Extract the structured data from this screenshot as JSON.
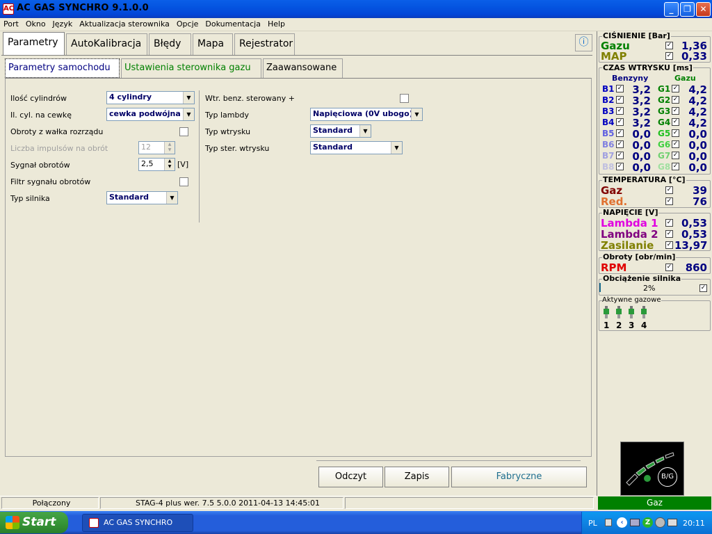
{
  "window": {
    "title": "AC GAS SYNCHRO  9.1.0.0",
    "icon_label": "AC"
  },
  "menu": [
    "Port",
    "Okno",
    "Język",
    "Aktualizacja sterownika",
    "Opcje",
    "Dokumentacja",
    "Help"
  ],
  "main_tabs": [
    "Parametry",
    "AutoKalibracja",
    "Błędy",
    "Mapa",
    "Rejestrator"
  ],
  "sub_tabs": [
    "Parametry samochodu",
    "Ustawienia sterownika gazu",
    "Zaawansowane"
  ],
  "left_form": {
    "cylinders": {
      "label": "Ilość cylindrów",
      "value": "4 cylindry"
    },
    "coil": {
      "label": "Il. cyl. na cewkę",
      "value": "cewka podwójna"
    },
    "camshaft": {
      "label": "Obroty z wałka rozrządu",
      "checked": false
    },
    "pulses": {
      "label": "Liczba impulsów na obrót",
      "value": "12"
    },
    "rpm_signal": {
      "label": "Sygnał obrotów",
      "value": "2,5",
      "unit": "[V]"
    },
    "rpm_filter": {
      "label": "Filtr sygnału obrotów",
      "checked": false
    },
    "engine_type": {
      "label": "Typ silnika",
      "value": "Standard"
    }
  },
  "right_form": {
    "petrol_inj": {
      "label": "Wtr. benz. sterowany +",
      "checked": false
    },
    "lambda": {
      "label": "Typ lambdy",
      "value": "Napięciowa (0V ubogo)"
    },
    "injection": {
      "label": "Typ wtrysku",
      "value": "Standard"
    },
    "inj_control": {
      "label": "Typ ster. wtrysku",
      "value": "Standard"
    }
  },
  "buttons": {
    "read": "Odczyt",
    "write": "Zapis",
    "factory": "Fabryczne"
  },
  "status": {
    "connection": "Połączony",
    "device": "STAG-4 plus   wer. 7.5  5.0.0    2011-04-13 14:45:01",
    "mode": "Gaz"
  },
  "pressure": {
    "title": "CIŚNIENIE [Bar]",
    "rows": [
      {
        "label": "Gazu",
        "value": "1,36",
        "color": "#008000"
      },
      {
        "label": "MAP",
        "value": "0,33",
        "color": "#808000"
      }
    ]
  },
  "injection_time": {
    "title": "CZAS WTRYSKU  [ms]",
    "col_petrol": "Benzyny",
    "col_gas": "Gazu",
    "rows": [
      {
        "b": "B1",
        "bv": "3,2",
        "g": "G1",
        "gv": "4,2"
      },
      {
        "b": "B2",
        "bv": "3,2",
        "g": "G2",
        "gv": "4,2"
      },
      {
        "b": "B3",
        "bv": "3,2",
        "g": "G3",
        "gv": "4,2"
      },
      {
        "b": "B4",
        "bv": "3,2",
        "g": "G4",
        "gv": "4,2"
      },
      {
        "b": "B5",
        "bv": "0,0",
        "g": "G5",
        "gv": "0,0"
      },
      {
        "b": "B6",
        "bv": "0,0",
        "g": "G6",
        "gv": "0,0"
      },
      {
        "b": "B7",
        "bv": "0,0",
        "g": "G7",
        "gv": "0,0"
      },
      {
        "b": "B8",
        "bv": "0,0",
        "g": "G8",
        "gv": "0,0"
      }
    ]
  },
  "temperature": {
    "title": "TEMPERATURA  [°C]",
    "rows": [
      {
        "label": "Gaz",
        "value": "39",
        "color": "#800000"
      },
      {
        "label": "Red.",
        "value": "76",
        "color": "#e07030"
      }
    ]
  },
  "voltage": {
    "title": "NAPIĘCIE [V]",
    "rows": [
      {
        "label": "Lambda 1",
        "value": "0,53",
        "color": "#e000e0"
      },
      {
        "label": "Lambda 2",
        "value": "0,53",
        "color": "#800080"
      },
      {
        "label": "Zasilanie",
        "value": "13,97",
        "color": "#808000"
      }
    ]
  },
  "rpm": {
    "title": "Obroty [obr/min]",
    "label": "RPM",
    "value": "860",
    "color": "#e00000"
  },
  "load": {
    "title": "Obciążenie silnika",
    "value": "2%",
    "fraction": 0.02
  },
  "active_gas": {
    "title": "Aktywne gazowe",
    "injectors": [
      "1",
      "2",
      "3",
      "4"
    ]
  },
  "switch": {
    "label": "B/G"
  },
  "taskbar": {
    "start": "Start",
    "task": "AC GAS SYNCHRO",
    "lang": "PL",
    "clock": "20:11"
  }
}
